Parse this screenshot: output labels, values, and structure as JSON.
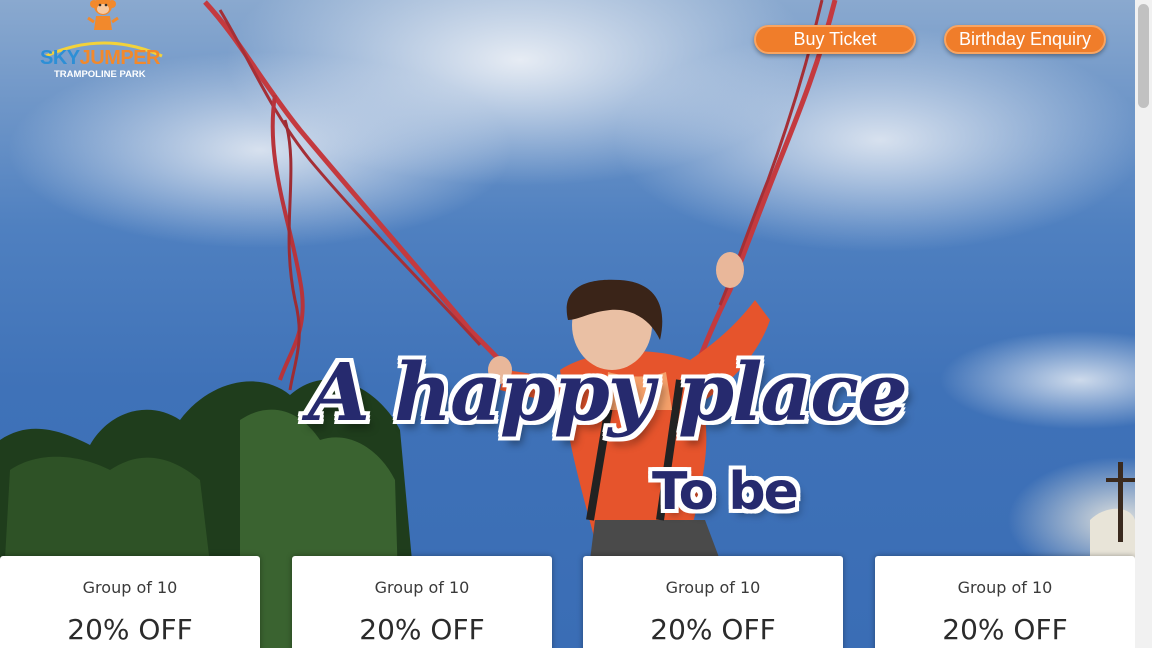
{
  "logo": {
    "brand_part1": "SKY",
    "brand_part2": "JUMPER",
    "tagline": "TRAMPOLINE PARK",
    "icon": "monkey-icon"
  },
  "nav": {
    "buy_ticket": "Buy Ticket",
    "birthday_enquiry": "Birthday Enquiry"
  },
  "hero": {
    "headline": "A happy place",
    "subline": "To be"
  },
  "offers": [
    {
      "group": "Group of 10",
      "discount": "20% OFF"
    },
    {
      "group": "Group of 10",
      "discount": "20% OFF"
    },
    {
      "group": "Group of 10",
      "discount": "20% OFF"
    },
    {
      "group": "Group of 10",
      "discount": "20% OFF"
    }
  ],
  "colors": {
    "accent": "#f07d2a",
    "brand_blue": "#2d8fd6",
    "headline": "#262a6e"
  }
}
